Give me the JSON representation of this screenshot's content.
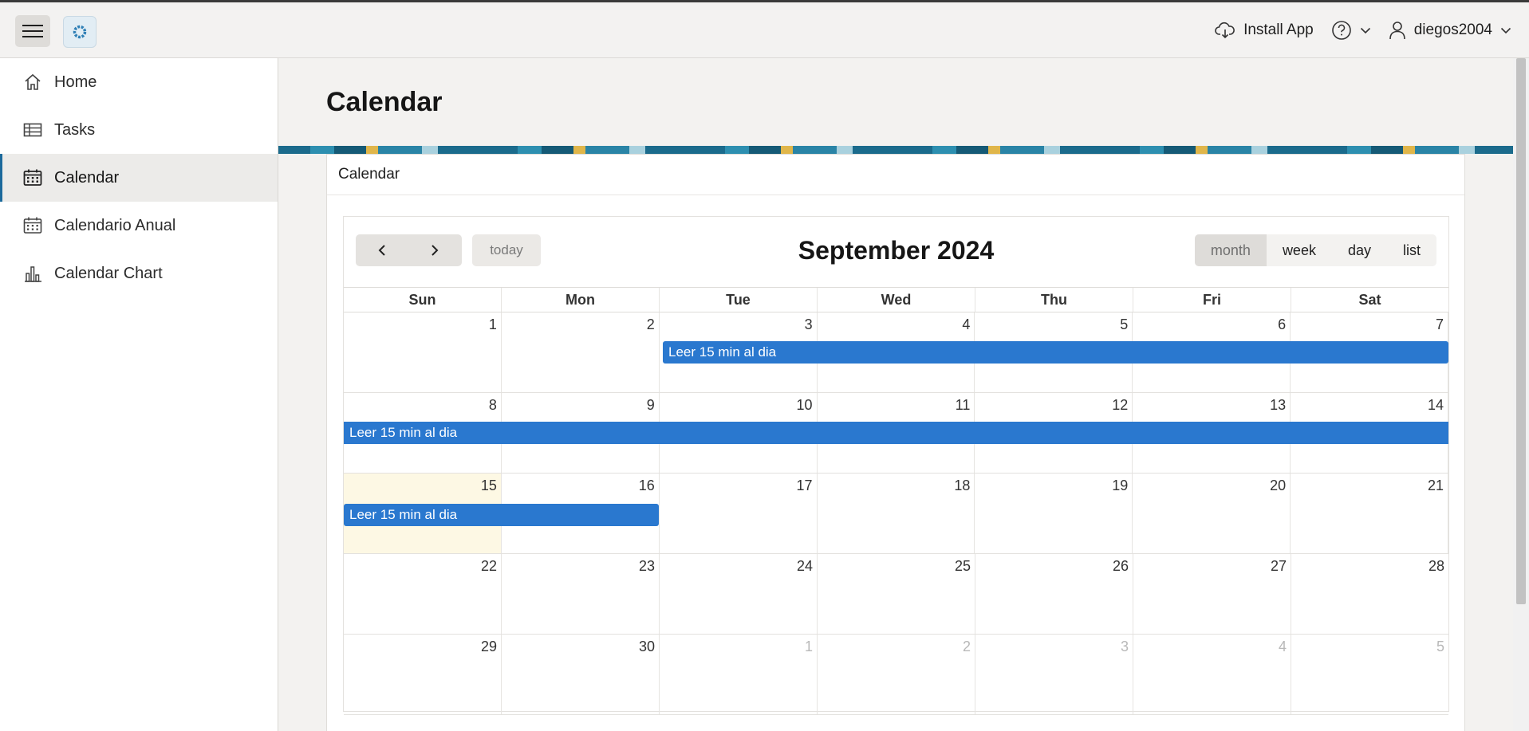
{
  "header": {
    "install_label": "Install App",
    "user_name": "diegos2004"
  },
  "sidebar": {
    "items": [
      {
        "label": "Home",
        "icon": "home-icon"
      },
      {
        "label": "Tasks",
        "icon": "table-icon"
      },
      {
        "label": "Calendar",
        "icon": "calendar-icon",
        "active": true
      },
      {
        "label": "Calendario Anual",
        "icon": "calendar-icon"
      },
      {
        "label": "Calendar Chart",
        "icon": "bar-chart-icon"
      }
    ]
  },
  "page": {
    "title": "Calendar",
    "region_title": "Calendar"
  },
  "calendar": {
    "title": "September 2024",
    "today_label": "today",
    "views": [
      "month",
      "week",
      "day",
      "list"
    ],
    "active_view": "month",
    "dow": [
      "Sun",
      "Mon",
      "Tue",
      "Wed",
      "Thu",
      "Fri",
      "Sat"
    ],
    "weeks": [
      [
        "1",
        "2",
        "3",
        "4",
        "5",
        "6",
        "7"
      ],
      [
        "8",
        "9",
        "10",
        "11",
        "12",
        "13",
        "14"
      ],
      [
        "15",
        "16",
        "17",
        "18",
        "19",
        "20",
        "21"
      ],
      [
        "22",
        "23",
        "24",
        "25",
        "26",
        "27",
        "28"
      ],
      [
        "29",
        "30",
        "1",
        "2",
        "3",
        "4",
        "5"
      ]
    ],
    "today": "2024-09-15",
    "event_title": "Leer 15 min al dia",
    "event_color": "#2a78cf"
  }
}
